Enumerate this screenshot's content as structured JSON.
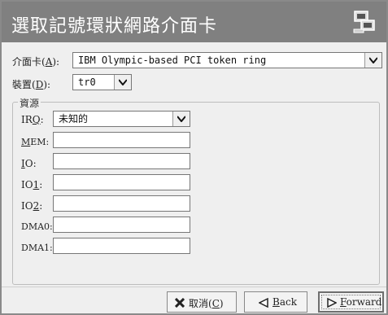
{
  "window": {
    "title": "選取記號環狀網路介面卡",
    "title_icon": "network-card-icon"
  },
  "adapter": {
    "label": "介面卡(",
    "accel": "A",
    "label_end": "):",
    "value": "IBM Olympic-based PCI token ring"
  },
  "device": {
    "label": "裝置(",
    "accel": "D",
    "label_end": "):",
    "value": "tr0"
  },
  "resources": {
    "group_title": "資源",
    "irq": {
      "pre": "IR",
      "accel": "Q",
      "post": ":",
      "value": "未知的"
    },
    "mem": {
      "pre": "",
      "accel": "M",
      "post": "EM:",
      "value": ""
    },
    "io": {
      "pre": "",
      "accel": "I",
      "post": "O:",
      "value": ""
    },
    "io1": {
      "pre": "IO",
      "accel": "1",
      "post": ":",
      "value": ""
    },
    "io2": {
      "pre": "IO",
      "accel": "2",
      "post": ":",
      "value": ""
    },
    "dma0": {
      "label": "DMA0:",
      "value": ""
    },
    "dma1": {
      "label": "DMA1:",
      "value": ""
    }
  },
  "buttons": {
    "cancel": {
      "label": "取消(",
      "accel": "C",
      "label_end": ")"
    },
    "back": {
      "accel": "B",
      "label_end": "ack"
    },
    "forward": {
      "accel": "F",
      "label_end": "orward"
    }
  }
}
